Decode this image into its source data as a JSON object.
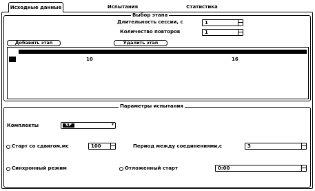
{
  "tabs": [
    {
      "label": "Исходные данные",
      "active": true
    },
    {
      "label": "Испытания",
      "active": false
    },
    {
      "label": "Статистика",
      "active": false
    }
  ],
  "stage_group": {
    "title": "Выбор этапа",
    "session_duration_label": "Длительность сессии, с",
    "session_duration_value": "1",
    "repeat_count_label": "Количество повторов",
    "repeat_count_value": "1",
    "add_stage_button": "Добавить этап",
    "delete_stage_button": "Удалить этап",
    "timeline_ticks": [
      "10",
      "16"
    ]
  },
  "test_params_group": {
    "title": "Параметры испытания",
    "sets_label": "Комплекты",
    "sets_value": "SP",
    "start_interval_label": "Старт со сдвигом,мс",
    "start_interval_value": "100",
    "connection_period_label": "Период между соединениями,с",
    "connection_period_value": "3",
    "sync_mode_label": "Синхронный режим",
    "delayed_start_label": "Отложенный старт",
    "delayed_start_value": "0:00"
  }
}
